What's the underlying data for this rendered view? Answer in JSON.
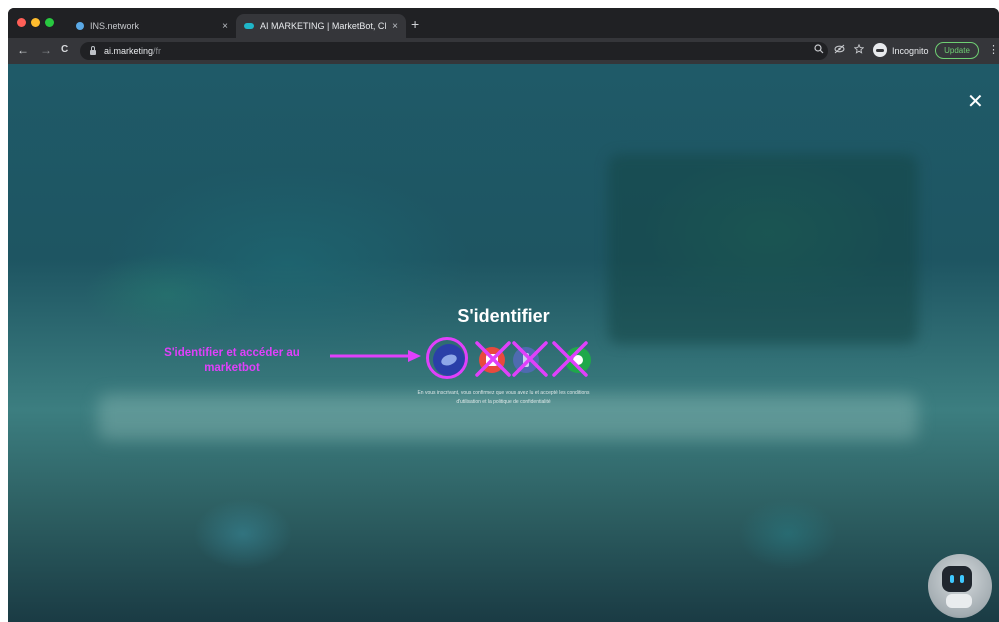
{
  "browser": {
    "tabs": [
      {
        "title": "INS.network",
        "active": false
      },
      {
        "title": "AI MARKETING | MarketBot, Cl",
        "active": true
      }
    ],
    "close_glyph": "×",
    "new_tab_glyph": "+",
    "nav": {
      "back": "←",
      "forward": "→",
      "reload": "C"
    },
    "url_host": "ai.marketing",
    "url_path": "/fr",
    "toolbar_icons": [
      "search-icon",
      "eye-off-icon",
      "star-icon"
    ],
    "incognito_label": "Incognito",
    "update_label": "Update",
    "menu_glyph": "⋮"
  },
  "overlay": {
    "close_glyph": "✕",
    "title": "S'identifier",
    "annotation": "S'identifier et accéder au marketbot",
    "providers": [
      {
        "name": "primary-provider",
        "highlighted": true,
        "crossed": false
      },
      {
        "name": "red-provider",
        "highlighted": false,
        "crossed": true
      },
      {
        "name": "blue-provider",
        "highlighted": false,
        "crossed": true
      },
      {
        "name": "green-provider",
        "highlighted": false,
        "crossed": true
      }
    ],
    "disclaimer_line1": "En vous inscrivant, vous confirmez que vous avez lu et accepté les conditions",
    "disclaimer_line2": "d'utilisation et la politique de confidentialité"
  },
  "colors": {
    "annotation": "#e040fb",
    "update": "#6fcf73",
    "primary_provider": "#2a3fa8"
  },
  "chatbot": {
    "icon": "robot-icon"
  }
}
